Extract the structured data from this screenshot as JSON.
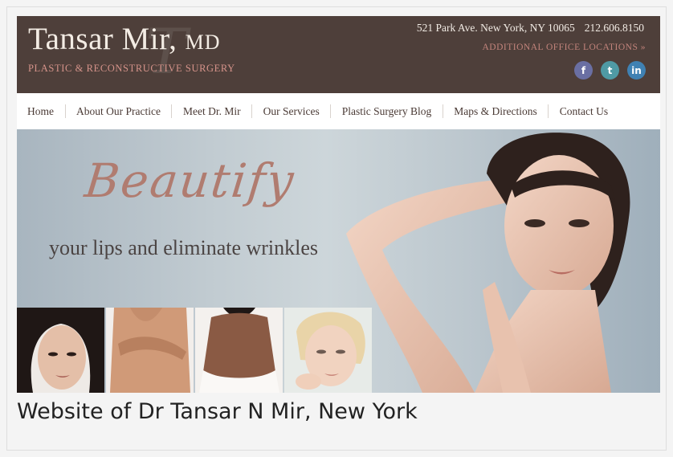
{
  "header": {
    "brand_name": "Tansar Mir,",
    "brand_suffix": "MD",
    "brand_watermark": "T",
    "subtitle": "PLASTIC & RECONSTRUCTIVE SURGERY",
    "address": "521 Park Ave. New York, NY 10065",
    "phone": "212.606.8150",
    "locations_link": "ADDITIONAL OFFICE LOCATIONS »",
    "social": [
      {
        "letter": "f",
        "icon": "facebook-icon",
        "color": "#6a6fa3"
      },
      {
        "letter": "t",
        "icon": "twitter-icon",
        "color": "#4f9aa4"
      },
      {
        "letter": "in",
        "icon": "linkedin-icon",
        "color": "#3f81b3"
      }
    ]
  },
  "nav": {
    "items": [
      "Home",
      "About Our Practice",
      "Meet Dr. Mir",
      "Our Services",
      "Plastic Surgery Blog",
      "Maps & Directions",
      "Contact Us"
    ]
  },
  "banner": {
    "headline": "Beautify",
    "tagline": "your lips and eliminate wrinkles"
  },
  "caption": "Website of Dr Tansar N Mir, New York",
  "colors": {
    "header_bg": "#4e3f3a",
    "accent": "#d5938a",
    "nav_text": "#4a3a35"
  }
}
